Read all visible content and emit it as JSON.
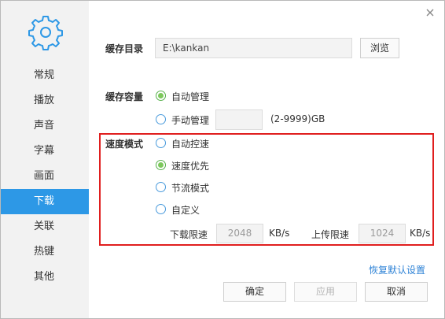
{
  "sidebar": {
    "icon": "gear-icon",
    "items": [
      {
        "label": "常规",
        "active": false
      },
      {
        "label": "播放",
        "active": false
      },
      {
        "label": "声音",
        "active": false
      },
      {
        "label": "字幕",
        "active": false
      },
      {
        "label": "画面",
        "active": false
      },
      {
        "label": "下载",
        "active": true
      },
      {
        "label": "关联",
        "active": false
      },
      {
        "label": "热键",
        "active": false
      },
      {
        "label": "其他",
        "active": false
      }
    ]
  },
  "close_icon": "close-icon",
  "cache_dir": {
    "label": "缓存目录",
    "value": "E:\\kankan",
    "browse_label": "浏览"
  },
  "cache_capacity": {
    "label": "缓存容量",
    "options": [
      {
        "label": "自动管理",
        "checked": true
      },
      {
        "label": "手动管理",
        "checked": false
      }
    ],
    "manual_value": "",
    "range_hint": "(2-9999)GB"
  },
  "speed_mode": {
    "label": "速度模式",
    "options": [
      {
        "label": "自动控速",
        "checked": false
      },
      {
        "label": "速度优先",
        "checked": true
      },
      {
        "label": "节流模式",
        "checked": false
      },
      {
        "label": "自定义",
        "checked": false
      }
    ],
    "download_limit_label": "下载限速",
    "download_limit_value": "2048",
    "download_unit": "KB/s",
    "upload_limit_label": "上传限速",
    "upload_limit_value": "1024",
    "upload_unit": "KB/s"
  },
  "restore_defaults": "恢复默认设置",
  "buttons": {
    "ok": "确定",
    "apply": "应用",
    "cancel": "取消"
  },
  "colors": {
    "accent": "#2d98e6",
    "highlight": "#e01e1e",
    "radio_checked": "#7cc85c"
  }
}
